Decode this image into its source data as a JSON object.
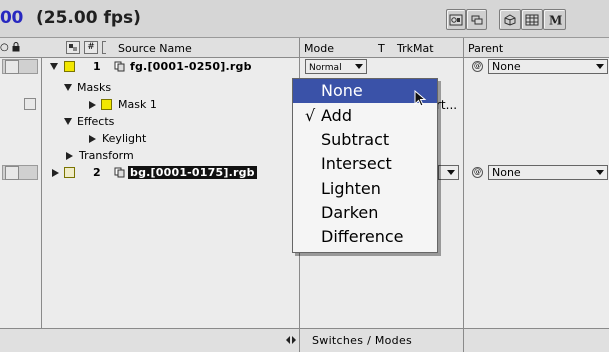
{
  "toolbar": {
    "timecode": "00",
    "fps": "(25.00 fps)"
  },
  "header": {
    "number_col": "#",
    "source_name": "Source Name",
    "mode": "Mode",
    "t_col": "T",
    "trkmat": "TrkMat",
    "parent": "Parent"
  },
  "layers": [
    {
      "number": "1",
      "source": "fg.[0001-0250].rgb",
      "mode_value": "Normal",
      "parent": "None"
    },
    {
      "number": "2",
      "source": "bg.[0001-0175].rgb",
      "mode_value": "",
      "parent": "None"
    }
  ],
  "properties": {
    "masks": "Masks",
    "mask1": "Mask 1",
    "effects": "Effects",
    "keylight": "Keylight",
    "transform": "Transform",
    "mask_mode_partial": "rt..."
  },
  "footer": {
    "switches_modes": "Switches / Modes"
  },
  "mode_menu": {
    "items": [
      "None",
      "Add",
      "Subtract",
      "Intersect",
      "Lighten",
      "Darken",
      "Difference"
    ],
    "highlighted": "None",
    "checked": "Add"
  },
  "colors": {
    "highlight": "#3a52a8",
    "label_yellow": "#f2e700",
    "timecode_blue": "#2828c0"
  }
}
